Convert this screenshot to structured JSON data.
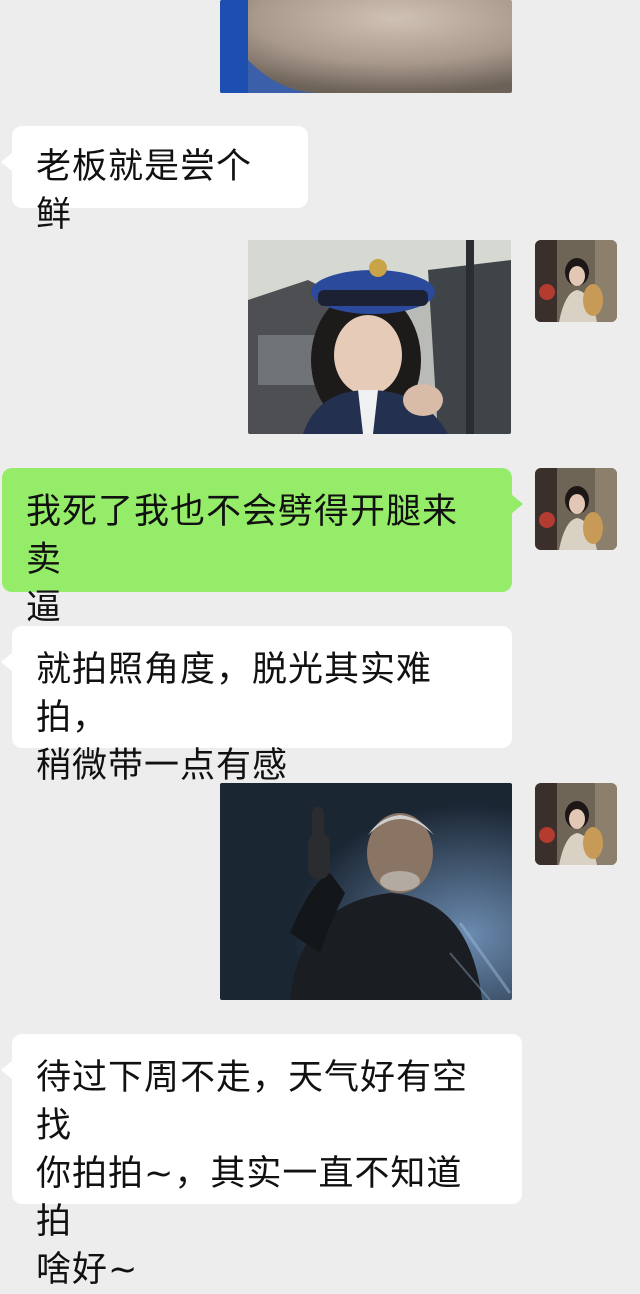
{
  "messages": [
    {
      "side": "left",
      "type": "text",
      "text": "老板就是尝个鲜"
    },
    {
      "side": "right",
      "type": "image",
      "image": "police-cap-girl-photo"
    },
    {
      "side": "right",
      "type": "text",
      "text": "我死了我也不会劈得开腿来卖\n逼"
    },
    {
      "side": "left",
      "type": "text",
      "text": "就拍照角度，脱光其实难拍，\n稍微带一点有感"
    },
    {
      "side": "right",
      "type": "image",
      "image": "thumbs-up-man-photo"
    },
    {
      "side": "left",
      "type": "text",
      "text": "待过下周不走，天气好有空找\n你拍拍~，其实一直不知道拍\n啥好~"
    }
  ],
  "colors": {
    "background": "#ededed",
    "incoming_bubble": "#ffffff",
    "outgoing_bubble": "#95ec69"
  }
}
